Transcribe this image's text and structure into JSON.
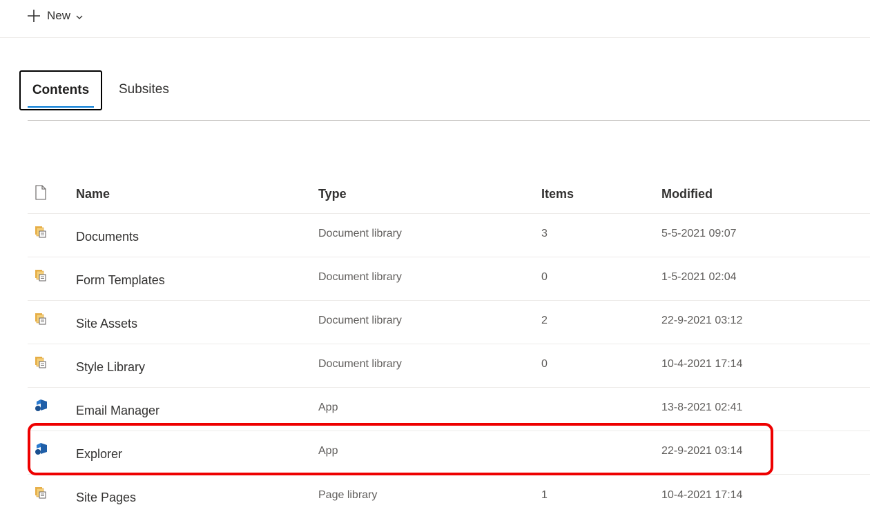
{
  "commandbar": {
    "new_label": "New",
    "new_icon": "plus-icon",
    "new_chevron_icon": "chevron-down-icon"
  },
  "tabs": [
    {
      "label": "Contents",
      "selected": true
    },
    {
      "label": "Subsites",
      "selected": false
    }
  ],
  "list": {
    "columns": {
      "icon": "document-icon",
      "name": "Name",
      "type": "Type",
      "items": "Items",
      "modified": "Modified"
    },
    "rows": [
      {
        "icon": "library-icon",
        "name": "Documents",
        "type": "Document library",
        "items": "3",
        "modified": "5-5-2021 09:07"
      },
      {
        "icon": "library-icon",
        "name": "Form Templates",
        "type": "Document library",
        "items": "0",
        "modified": "1-5-2021 02:04"
      },
      {
        "icon": "library-icon",
        "name": "Site Assets",
        "type": "Document library",
        "items": "2",
        "modified": "22-9-2021 03:12"
      },
      {
        "icon": "library-icon",
        "name": "Style Library",
        "type": "Document library",
        "items": "0",
        "modified": "10-4-2021 17:14"
      },
      {
        "icon": "app-icon",
        "name": "Email Manager",
        "type": "App",
        "items": "",
        "modified": "13-8-2021 02:41"
      },
      {
        "icon": "app-icon",
        "name": "Explorer",
        "type": "App",
        "items": "",
        "modified": "22-9-2021 03:14",
        "highlighted": true
      },
      {
        "icon": "library-icon",
        "name": "Site Pages",
        "type": "Page library",
        "items": "1",
        "modified": "10-4-2021 17:14"
      }
    ]
  },
  "colors": {
    "accent": "#0078d4",
    "highlight": "#ee0000",
    "library_icon": "#e8b04a",
    "app_icon": "#1f5fa8"
  }
}
